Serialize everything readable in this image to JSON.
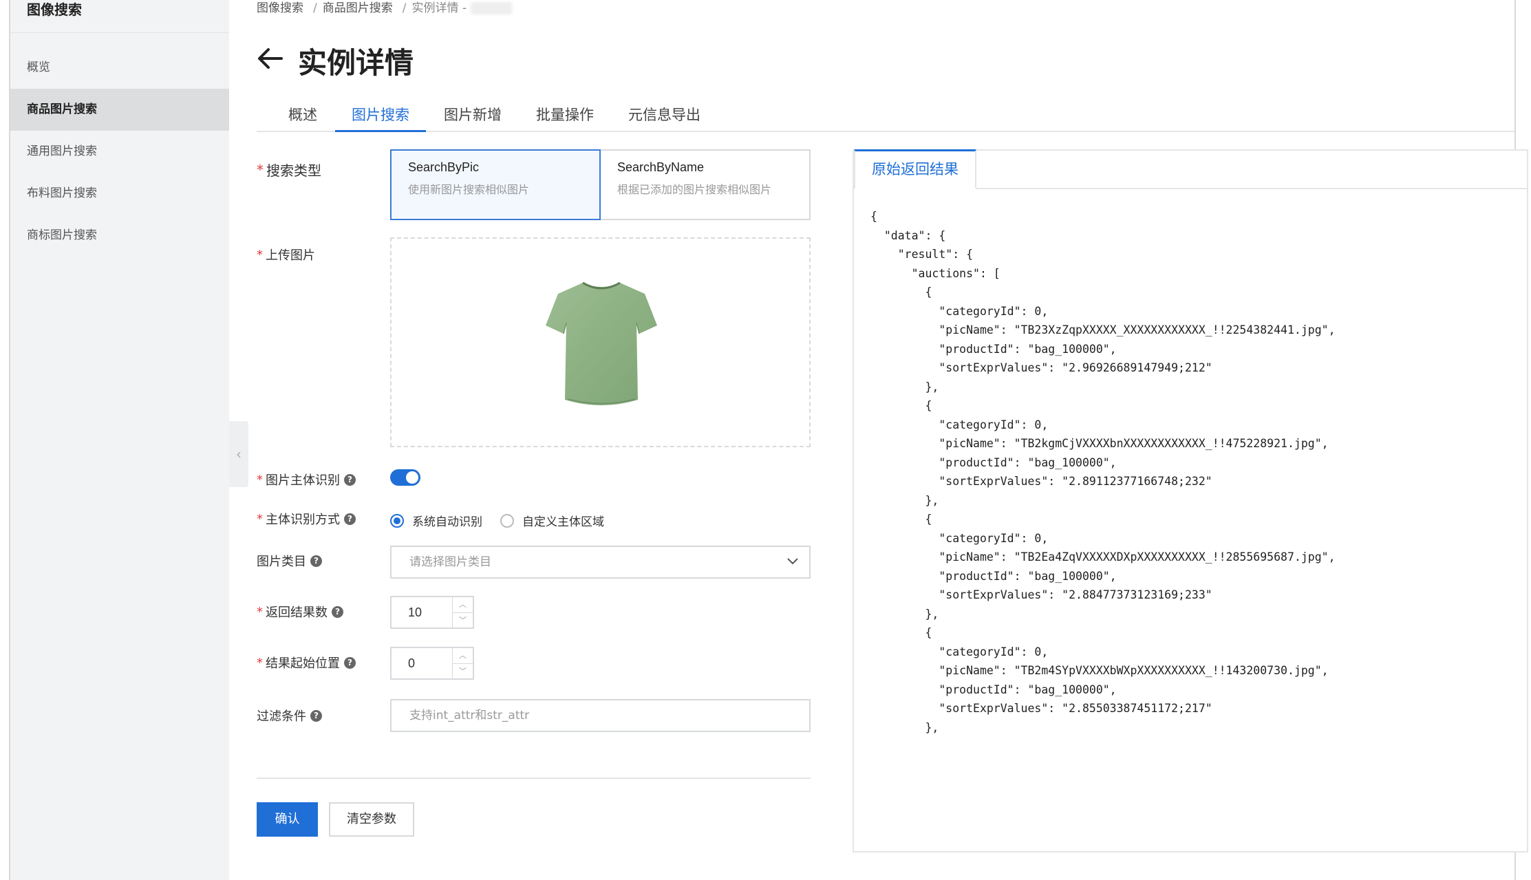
{
  "sidebar": {
    "title": "图像搜索",
    "items": [
      {
        "label": "概览"
      },
      {
        "label": "商品图片搜索"
      },
      {
        "label": "通用图片搜索"
      },
      {
        "label": "布料图片搜索"
      },
      {
        "label": "商标图片搜索"
      }
    ]
  },
  "breadcrumb": {
    "items": [
      "图像搜索",
      "商品图片搜索",
      "实例详情 -"
    ]
  },
  "page": {
    "title": "实例详情"
  },
  "tabs": [
    {
      "label": "概述"
    },
    {
      "label": "图片搜索",
      "active": true
    },
    {
      "label": "图片新增"
    },
    {
      "label": "批量操作"
    },
    {
      "label": "元信息导出"
    }
  ],
  "form": {
    "search_type": {
      "label": "搜索类型",
      "options": [
        {
          "title": "SearchByPic",
          "desc": "使用新图片搜索相似图片",
          "selected": true
        },
        {
          "title": "SearchByName",
          "desc": "根据已添加的图片搜索相似图片",
          "selected": false
        }
      ]
    },
    "upload": {
      "label": "上传图片"
    },
    "subject_detect": {
      "label": "图片主体识别",
      "enabled": true
    },
    "detect_mode": {
      "label": "主体识别方式",
      "options": [
        {
          "label": "系统自动识别",
          "checked": true
        },
        {
          "label": "自定义主体区域",
          "checked": false
        }
      ]
    },
    "category": {
      "label": "图片类目",
      "placeholder": "请选择图片类目"
    },
    "result_count": {
      "label": "返回结果数",
      "value": "10"
    },
    "start_pos": {
      "label": "结果起始位置",
      "value": "0"
    },
    "filter": {
      "label": "过滤条件",
      "placeholder": "支持int_attr和str_attr"
    },
    "confirm_label": "确认",
    "clear_label": "清空参数"
  },
  "result": {
    "tab_label": "原始返回结果",
    "json_text": "{\n  \"data\": {\n    \"result\": {\n      \"auctions\": [\n        {\n          \"categoryId\": 0,\n          \"picName\": \"TB23XzZqpXXXXX_XXXXXXXXXXXX_!!2254382441.jpg\",\n          \"productId\": \"bag_100000\",\n          \"sortExprValues\": \"2.96926689147949;212\"\n        },\n        {\n          \"categoryId\": 0,\n          \"picName\": \"TB2kgmCjVXXXXbnXXXXXXXXXXXX_!!475228921.jpg\",\n          \"productId\": \"bag_100000\",\n          \"sortExprValues\": \"2.89112377166748;232\"\n        },\n        {\n          \"categoryId\": 0,\n          \"picName\": \"TB2Ea4ZqVXXXXXDXpXXXXXXXXXX_!!2855695687.jpg\",\n          \"productId\": \"bag_100000\",\n          \"sortExprValues\": \"2.88477373123169;233\"\n        },\n        {\n          \"categoryId\": 0,\n          \"picName\": \"TB2m4SYpVXXXXbWXpXXXXXXXXXX_!!143200730.jpg\",\n          \"productId\": \"bag_100000\",\n          \"sortExprValues\": \"2.85503387451172;217\"\n        },"
  },
  "icons": {
    "back": "arrow-left-icon",
    "collapse": "chevron-left-icon",
    "help": "question-circle-icon",
    "dropdown": "chevron-down-icon"
  },
  "colors": {
    "accent": "#1f6fd6",
    "required": "#e23d3d",
    "shirt": "#8fb185"
  }
}
